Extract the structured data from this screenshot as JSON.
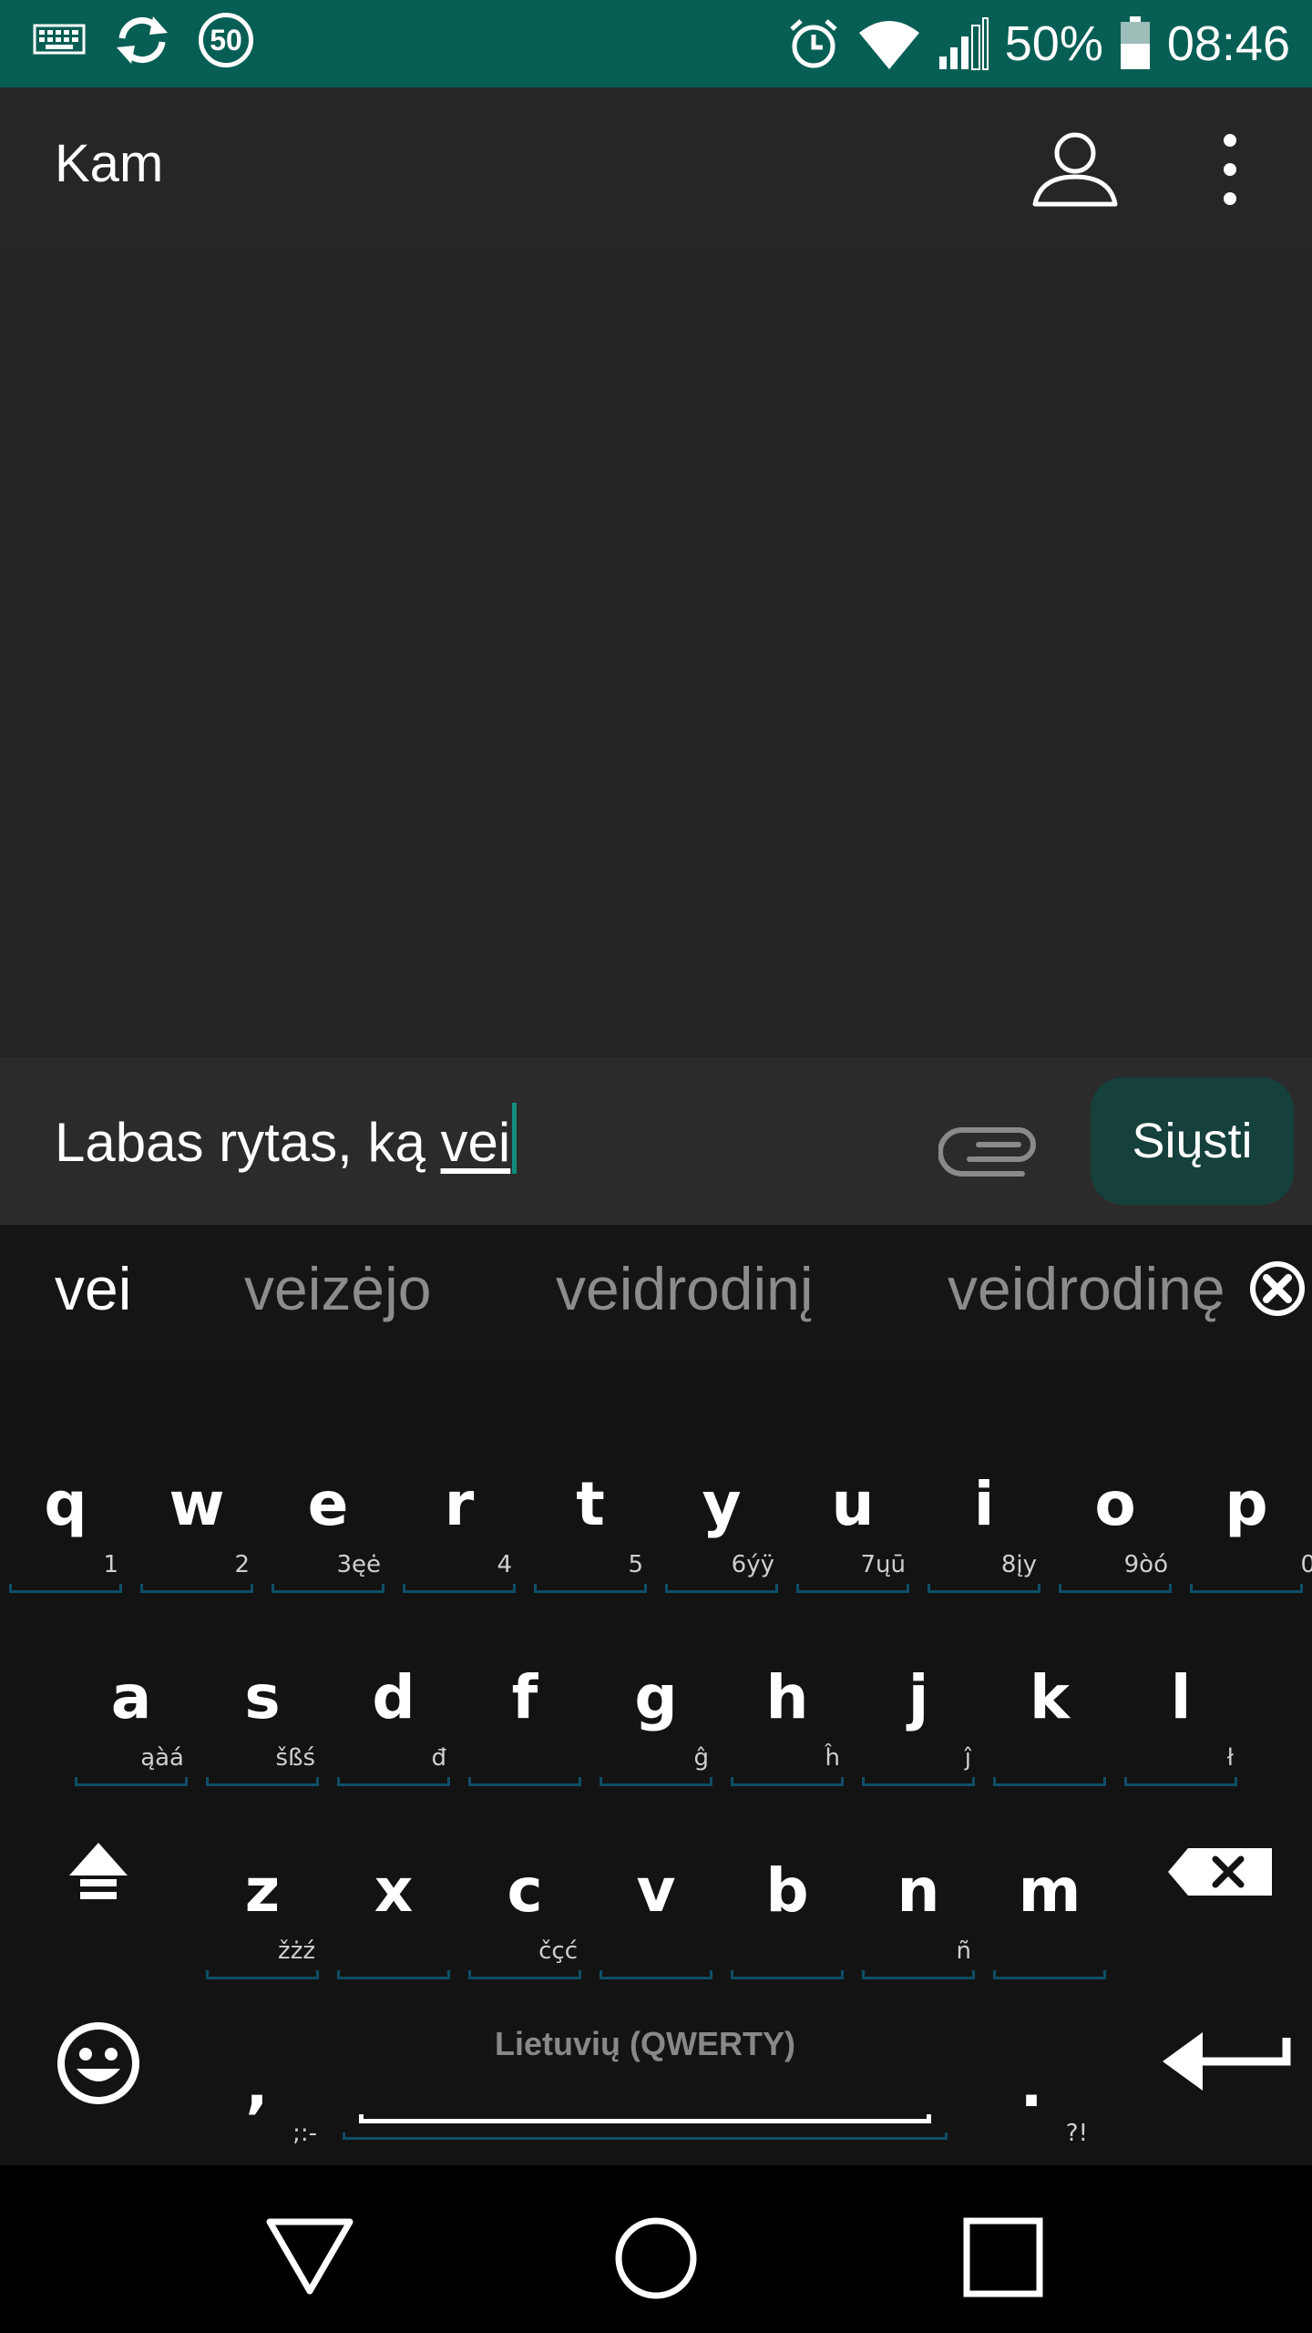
{
  "status_bar": {
    "badge": "50",
    "battery": "50%",
    "time": "08:46"
  },
  "app_bar": {
    "title": "Kam"
  },
  "compose": {
    "text_before": "Labas rytas, ką ",
    "text_composing": "vei",
    "send_label": "Siųsti"
  },
  "suggestions": [
    "vei",
    "veizėjo",
    "veidrodinį",
    "veidrodinę"
  ],
  "keyboard": {
    "row1": [
      {
        "key": "q",
        "hint": "1"
      },
      {
        "key": "w",
        "hint": "2"
      },
      {
        "key": "e",
        "hint": "3ęė"
      },
      {
        "key": "r",
        "hint": "4"
      },
      {
        "key": "t",
        "hint": "5"
      },
      {
        "key": "y",
        "hint": "6ýÿ"
      },
      {
        "key": "u",
        "hint": "7ųū"
      },
      {
        "key": "i",
        "hint": "8įy"
      },
      {
        "key": "o",
        "hint": "9òó"
      },
      {
        "key": "p",
        "hint": "0"
      }
    ],
    "row2": [
      {
        "key": "a",
        "hint": "ąàá"
      },
      {
        "key": "s",
        "hint": "šßś"
      },
      {
        "key": "d",
        "hint": "đ"
      },
      {
        "key": "f",
        "hint": ""
      },
      {
        "key": "g",
        "hint": "ĝ"
      },
      {
        "key": "h",
        "hint": "ĥ"
      },
      {
        "key": "j",
        "hint": "ĵ"
      },
      {
        "key": "k",
        "hint": ""
      },
      {
        "key": "l",
        "hint": "ł"
      }
    ],
    "row3": [
      {
        "key": "z",
        "hint": "žżź"
      },
      {
        "key": "x",
        "hint": ""
      },
      {
        "key": "c",
        "hint": "čçć"
      },
      {
        "key": "v",
        "hint": ""
      },
      {
        "key": "b",
        "hint": ""
      },
      {
        "key": "n",
        "hint": "ñ"
      },
      {
        "key": "m",
        "hint": ""
      }
    ],
    "comma": {
      "key": ",",
      "hint": ";:-"
    },
    "period": {
      "key": ".",
      "hint": "?!"
    },
    "space_label": "Lietuvių (QWERTY)"
  },
  "colors": {
    "status_bar": "#075e54",
    "send_button": "#15403b",
    "cursor": "#128c7e",
    "key_underline": "#0f4e66"
  }
}
